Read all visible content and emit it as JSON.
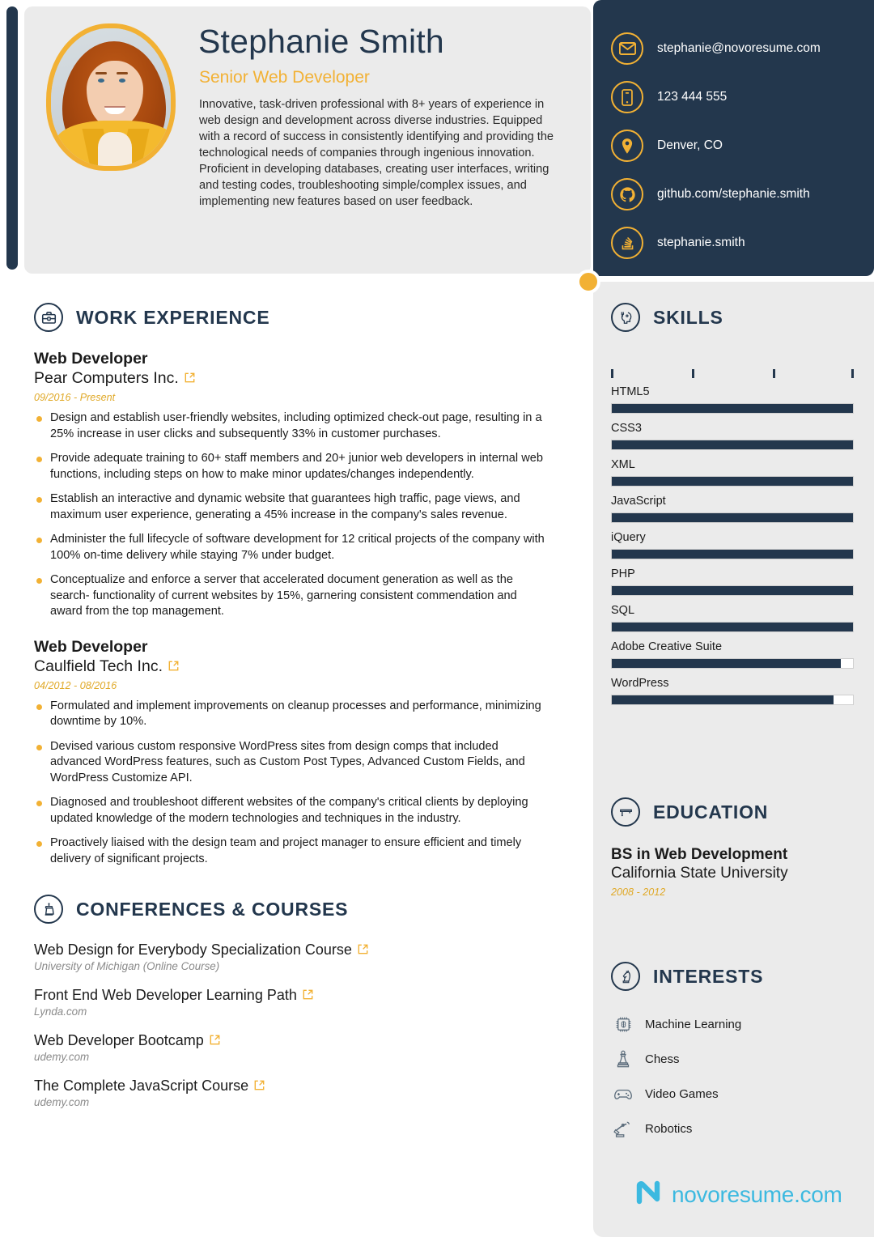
{
  "colors": {
    "navy": "#23374d",
    "yellow": "#f2b134",
    "grey_card": "#ebebeb",
    "cyan": "#3cb9e0",
    "muted": "#8a8a8a"
  },
  "header": {
    "name": "Stephanie Smith",
    "job_title": "Senior Web Developer",
    "summary": "Innovative, task-driven professional with 8+ years of experience in web design and development across diverse industries. Equipped with a record of success in consistently identifying and providing the technological needs of companies through ingenious innovation. Proficient in developing databases, creating user interfaces, writing and testing codes, troubleshooting simple/complex issues, and implementing new features based on user feedback.",
    "photo_alt": "profile-photo"
  },
  "contacts": [
    {
      "icon": "email-icon",
      "value": "stephanie@novoresume.com"
    },
    {
      "icon": "phone-icon",
      "value": "123 444 555"
    },
    {
      "icon": "location-pin-icon",
      "value": "Denver, CO"
    },
    {
      "icon": "github-icon",
      "value": "github.com/stephanie.smith"
    },
    {
      "icon": "stackoverflow-icon",
      "value": "stephanie.smith"
    }
  ],
  "sections": {
    "work_experience": {
      "icon": "briefcase-icon",
      "title": "WORK EXPERIENCE"
    },
    "conferences": {
      "icon": "podium-icon",
      "title": "CONFERENCES & COURSES"
    },
    "skills": {
      "icon": "skills-head-icon",
      "title": "SKILLS"
    },
    "education": {
      "icon": "graduation-cap-icon",
      "title": "EDUCATION"
    },
    "interests": {
      "icon": "chess-knight-icon",
      "title": "INTERESTS"
    }
  },
  "jobs": [
    {
      "role": "Web Developer",
      "company": "Pear Computers Inc.",
      "link_icon": "external-link-icon",
      "date": "09/2016 - Present",
      "bullets": [
        "Design and establish user-friendly websites, including optimized check-out page, resulting in a 25% increase in user clicks and subsequently 33% in customer purchases.",
        "Provide adequate training to 60+ staff members and 20+ junior web developers in internal web functions, including steps on how to make minor updates/changes independently.",
        "Establish an interactive and dynamic website that guarantees high traffic, page views, and maximum user experience, generating a 45% increase in the company's sales revenue.",
        "Administer the full lifecycle of software development for 12 critical projects of the company with 100% on-time delivery while staying 7% under budget.",
        "Conceptualize and enforce a server that accelerated document generation as well as the search- functionality of current websites by 15%, garnering consistent commendation and award from the top management."
      ]
    },
    {
      "role": "Web Developer",
      "company": "Caulfield Tech Inc.",
      "link_icon": "external-link-icon",
      "date": "04/2012 - 08/2016",
      "bullets": [
        "Formulated and implement improvements on cleanup processes and performance, minimizing downtime by 10%.",
        "Devised various custom responsive WordPress sites from design comps that included advanced WordPress features, such as Custom Post Types, Advanced Custom Fields, and WordPress Customize API.",
        "Diagnosed and troubleshoot different websites of the company's critical clients by deploying updated knowledge of the modern technologies and techniques in the industry.",
        "Proactively liaised with the design team and project manager to ensure efficient and timely delivery of significant projects."
      ]
    }
  ],
  "conferences": [
    {
      "title": "Web Design for Everybody Specialization Course",
      "source": "University of Michigan (Online Course)"
    },
    {
      "title": "Front End Web Developer Learning Path",
      "source": "Lynda.com"
    },
    {
      "title": "Web Developer Bootcamp",
      "source": "udemy.com"
    },
    {
      "title": "The Complete JavaScript Course",
      "source": "udemy.com"
    }
  ],
  "skills": {
    "tick_count": 4,
    "items": [
      {
        "name": "HTML5",
        "level": 100
      },
      {
        "name": "CSS3",
        "level": 100
      },
      {
        "name": "XML",
        "level": 100
      },
      {
        "name": "JavaScript",
        "level": 100
      },
      {
        "name": "iQuery",
        "level": 100
      },
      {
        "name": "PHP",
        "level": 100
      },
      {
        "name": "SQL",
        "level": 100
      },
      {
        "name": "Adobe Creative Suite",
        "level": 95
      },
      {
        "name": "WordPress",
        "level": 92
      }
    ]
  },
  "education": [
    {
      "degree": "BS in Web Development",
      "school": "California State University",
      "date": "2008 - 2012"
    }
  ],
  "interests": [
    {
      "icon": "microchip-brain-icon",
      "label": "Machine Learning"
    },
    {
      "icon": "chess-piece-icon",
      "label": "Chess"
    },
    {
      "icon": "gamepad-icon",
      "label": "Video Games"
    },
    {
      "icon": "robot-arm-icon",
      "label": "Robotics"
    }
  ],
  "footer": {
    "logo_icon": "novoresume-logo-icon",
    "logo_text": "novoresume.com"
  }
}
